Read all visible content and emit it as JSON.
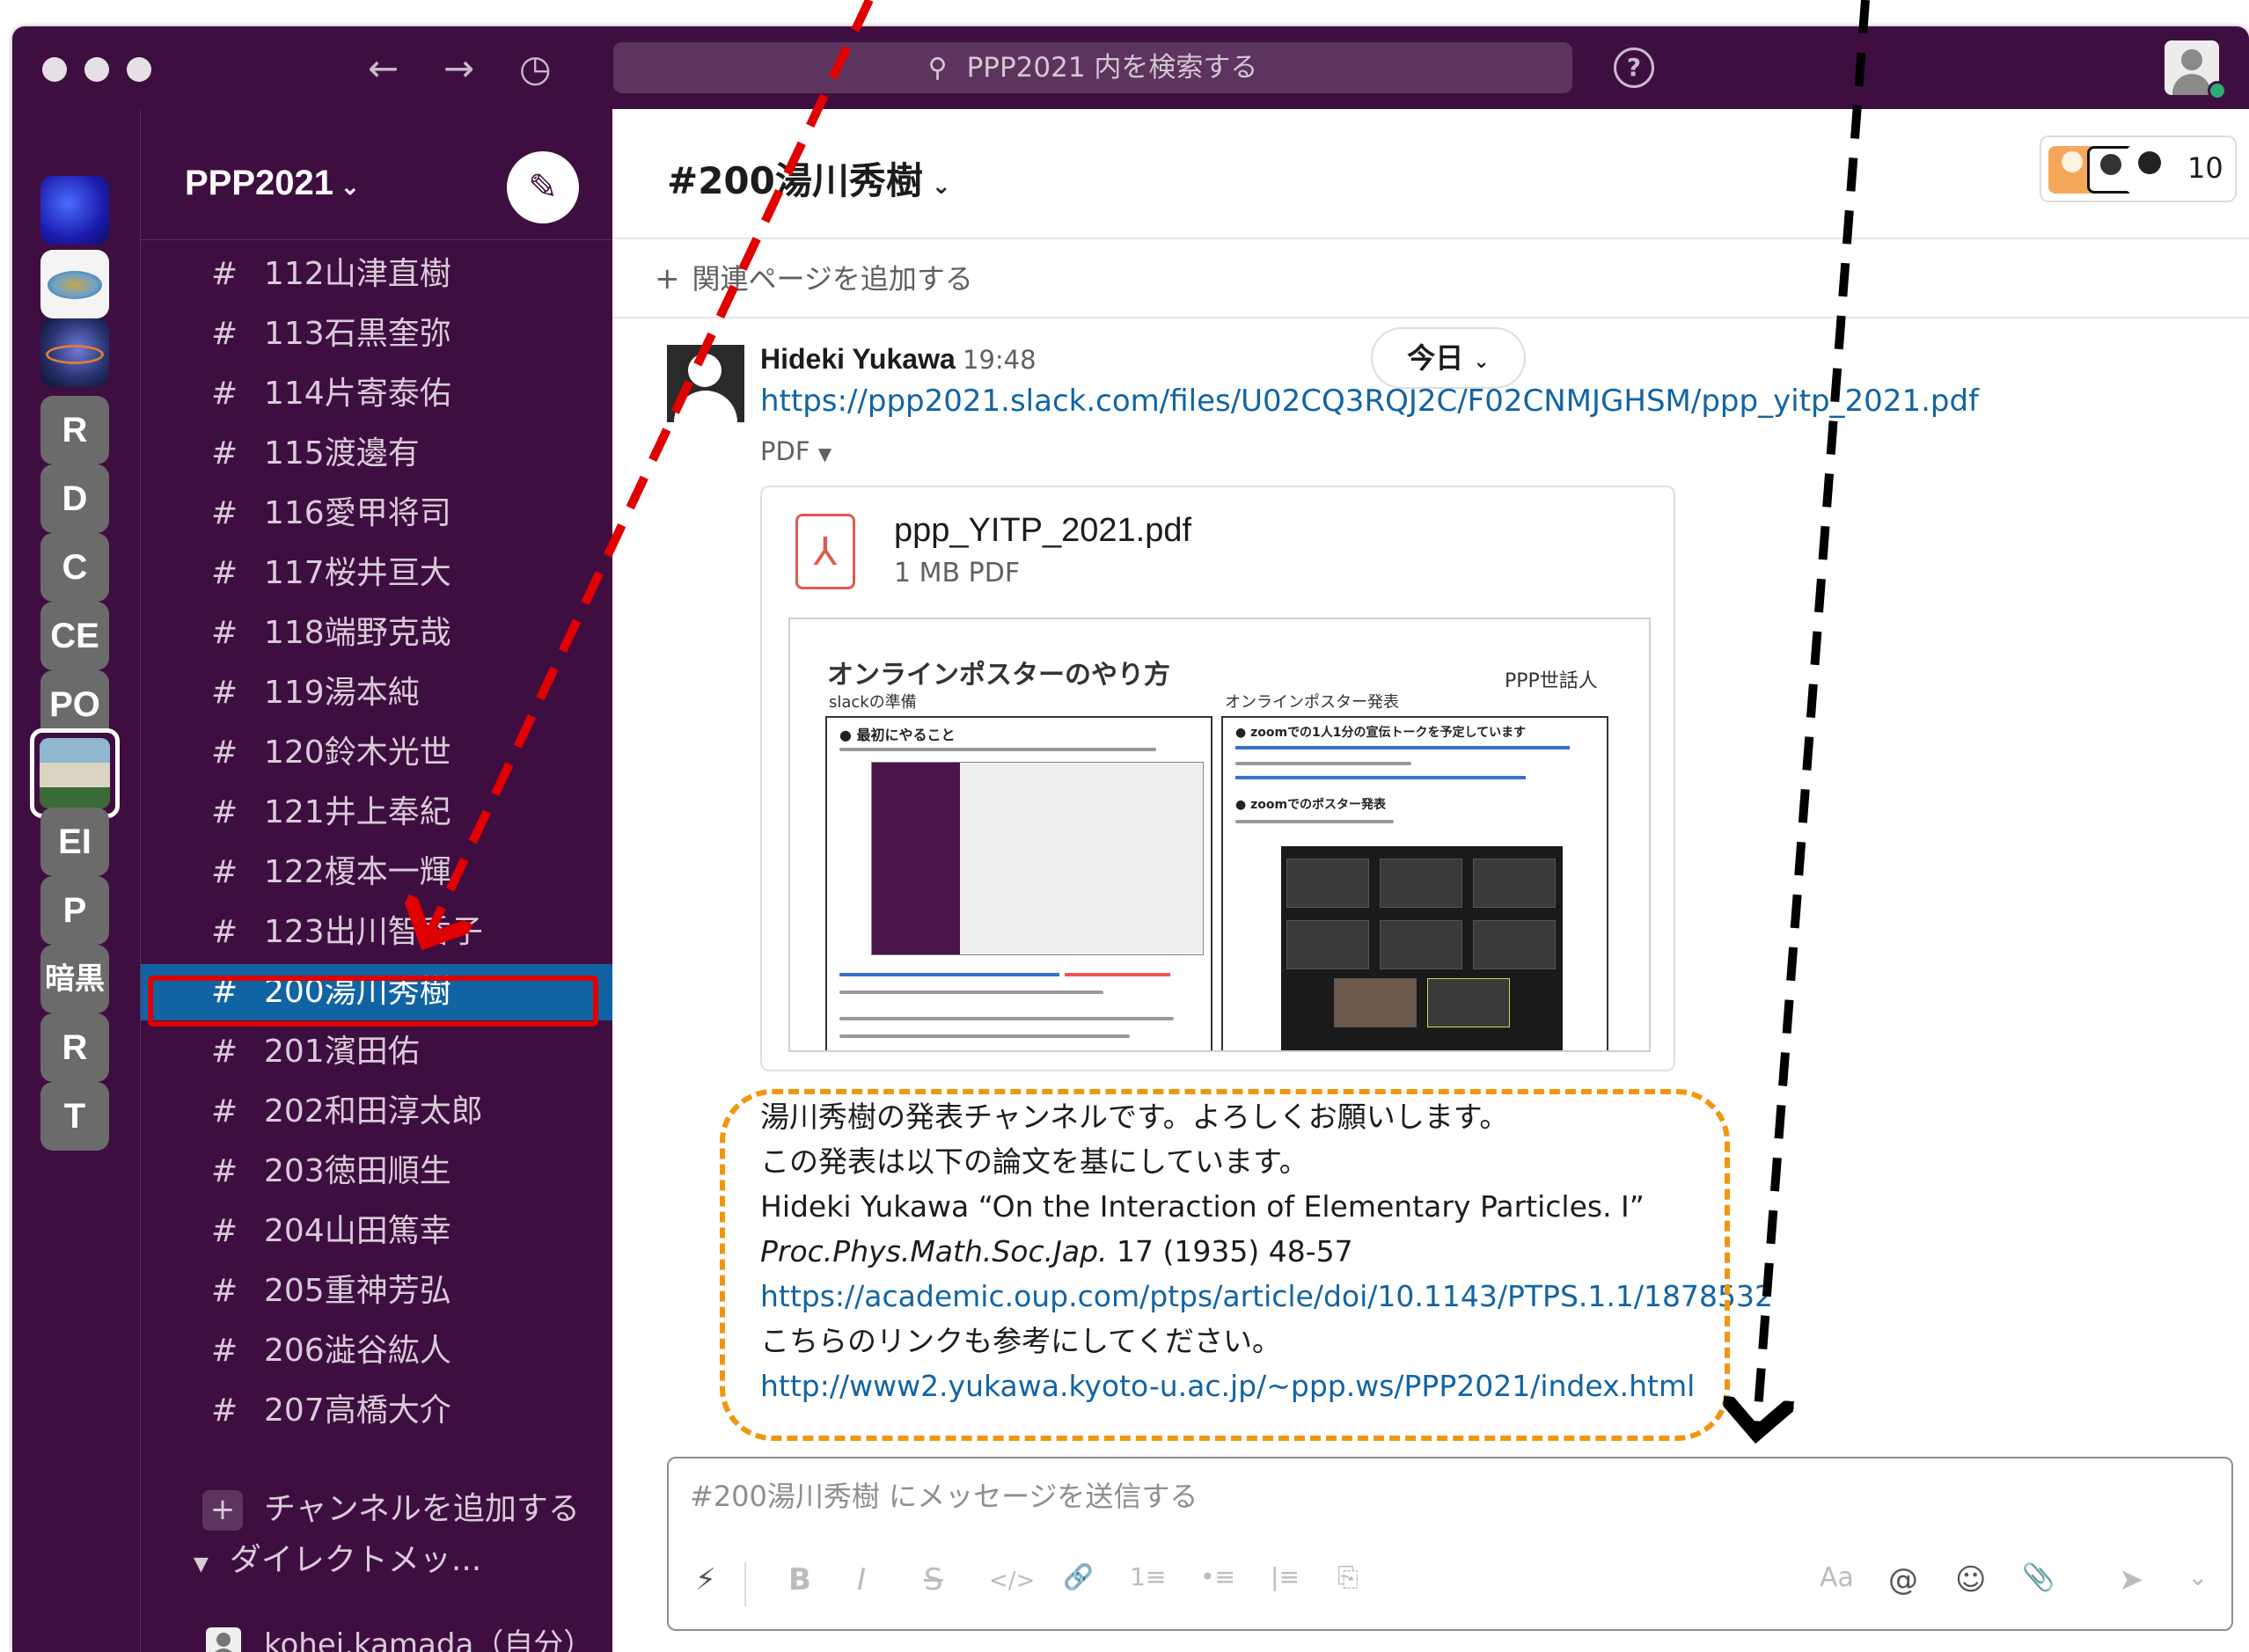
{
  "titlebar": {
    "search_placeholder": "PPP2021 内を検索する",
    "help_label": "?"
  },
  "rail": {
    "workspaces": [
      {
        "label": "",
        "type": "image"
      },
      {
        "label": "",
        "type": "image"
      },
      {
        "label": "",
        "type": "image"
      },
      {
        "label": "R"
      },
      {
        "label": "D"
      },
      {
        "label": "C"
      },
      {
        "label": "CE"
      },
      {
        "label": "PO"
      },
      {
        "label": "",
        "type": "image",
        "selected": true
      },
      {
        "label": "EI"
      },
      {
        "label": "P"
      },
      {
        "label": "暗黒"
      },
      {
        "label": "R"
      },
      {
        "label": "T"
      }
    ]
  },
  "sidebar": {
    "workspace_name": "PPP2021",
    "channels": [
      "112山津直樹",
      "113石黒奎弥",
      "114片寄泰佑",
      "115渡邊有",
      "116愛甲将司",
      "117桜井亘大",
      "118端野克哉",
      "119湯本純",
      "120鈴木光世",
      "121井上奉紀",
      "122榎本一輝",
      "123出川智香子",
      "200湯川秀樹",
      "201濱田佑",
      "202和田淳太郎",
      "203徳田順生",
      "204山田篤幸",
      "205重神芳弘",
      "206澁谷紘人",
      "207高橋大介"
    ],
    "hash": "#",
    "active_channel": "200湯川秀樹",
    "add_channel_label": "チャンネルを追加する",
    "dm_section_label": "ダイレクトメッ...",
    "dm_user": "kohei.kamada（自分）"
  },
  "main": {
    "channel_title": "#200湯川秀樹",
    "member_count": "10",
    "bookmark_label": "関連ページを追加する",
    "today_label": "今日",
    "message": {
      "sender": "Hideki Yukawa",
      "time": "19:48",
      "file_url": "https://ppp2021.slack.com/files/U02CQ3RQJ2C/F02CNMJGHSM/ppp_yitp_2021.pdf",
      "pdf_toggle": "PDF",
      "file_name": "ppp_YITP_2021.pdf",
      "file_meta": "1 MB PDF",
      "preview": {
        "title": "オンラインポスターのやり方",
        "org": "PPP世話人",
        "section_left": "slackの準備",
        "section_right": "オンラインポスター発表",
        "bullet_left": "● 最初にやること",
        "bullet_right1": "● zoomでの1人1分の宣伝トークを予定しています",
        "bullet_right2": "● zoomでのポスター発表"
      },
      "lines": {
        "l1": "湯川秀樹の発表チャンネルです。よろしくお願いします。",
        "l2": "この発表は以下の論文を基にしています。",
        "l3": "Hideki Yukawa “On the Interaction of Elementary Particles. I”",
        "l4_italic": "Proc.Phys.Math.Soc.Jap.",
        "l4_rest": " 17 (1935) 48-57",
        "l5": "https://academic.oup.com/ptps/article/doi/10.1143/PTPS.1.1/1878532",
        "l6": "こちらのリンクも参考にしてください。",
        "l7": "http://www2.yukawa.kyoto-u.ac.jp/~ppp.ws/PPP2021/index.html"
      }
    },
    "composer_placeholder": "#200湯川秀樹 にメッセージを送信する",
    "toolbar": {
      "shortcuts": "⚡",
      "bold": "B",
      "italic": "I",
      "strike": "S",
      "code": "</>",
      "link": "🔗",
      "ordered_list": "1≡",
      "bullet_list": "•≡",
      "quote": "|≡",
      "code_block": "⎘",
      "formatting": "Aa",
      "mention": "@",
      "emoji": "☺",
      "attach": "📎",
      "send": "➤",
      "send_options": "⌄"
    }
  },
  "colors": {
    "sidebar_bg": "#3f0e40",
    "active_channel_bg": "#1164a3",
    "link": "#1264a3",
    "highlight_box": "#e00000",
    "orange_box": "#f0960f",
    "presence": "#2bac76"
  }
}
